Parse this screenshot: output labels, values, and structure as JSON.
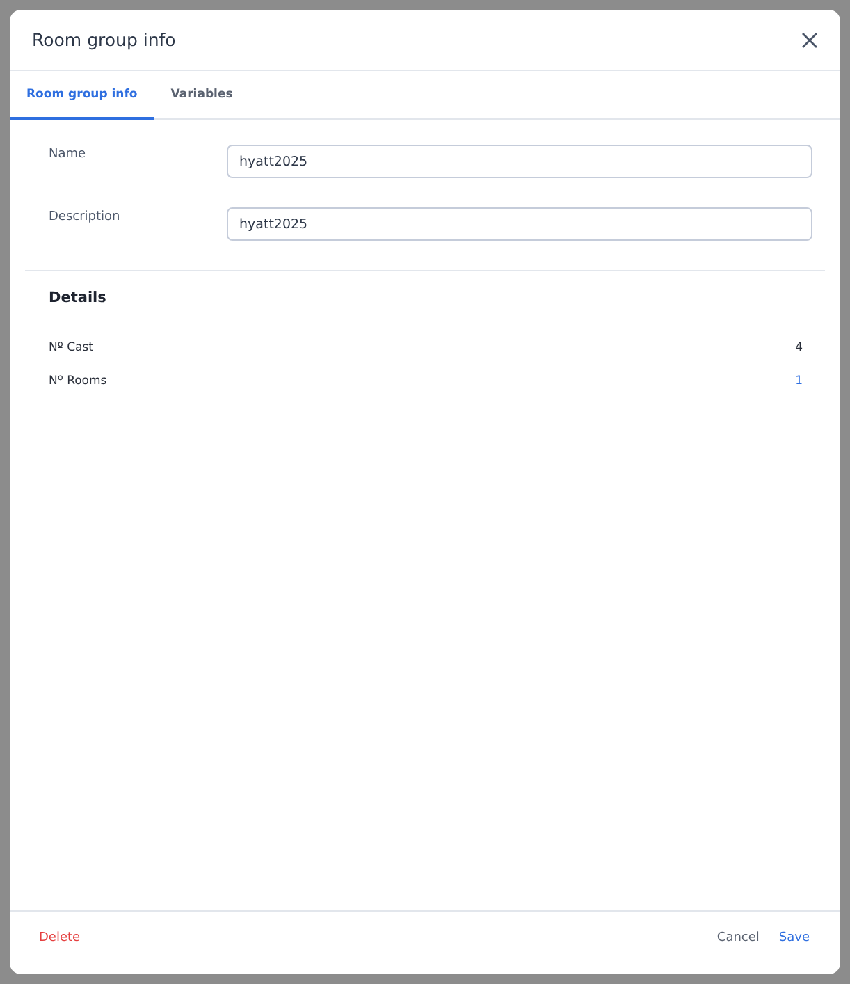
{
  "dialog": {
    "title": "Room group info"
  },
  "tabs": [
    {
      "label": "Room group info",
      "selected": true
    },
    {
      "label": "Variables",
      "selected": false
    }
  ],
  "fields": [
    {
      "label": "Name",
      "value": "hyatt2025"
    },
    {
      "label": "Description",
      "value": "hyatt2025"
    }
  ],
  "details": {
    "title": "Details",
    "rows": [
      {
        "label": "Nº Cast",
        "value": "4",
        "kind": "text"
      },
      {
        "label": "Nº Rooms",
        "value": "1",
        "kind": "link"
      }
    ]
  },
  "footer": {
    "delete": "Delete",
    "cancel": "Cancel",
    "save": "Save"
  }
}
